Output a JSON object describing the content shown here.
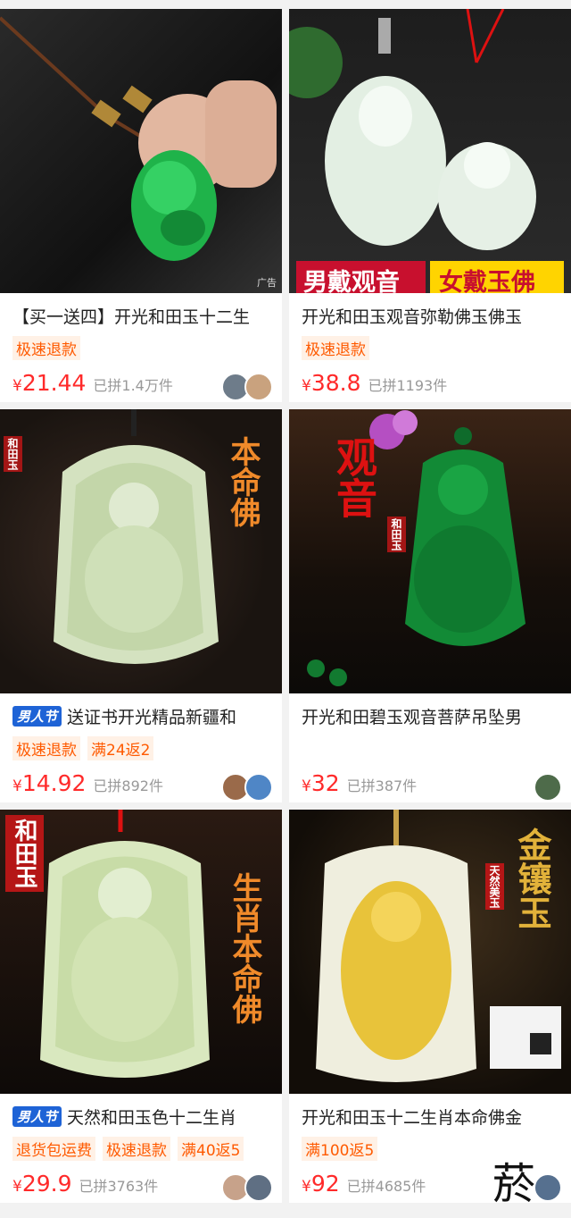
{
  "products": [
    {
      "title": "【买一送四】开光和田玉十二生",
      "festival": "",
      "tags": [
        "极速退款"
      ],
      "price": "21.44",
      "sold": "已拼1.4万件",
      "ad_label": "广告",
      "image_text": [],
      "avatars": 2
    },
    {
      "title": "开光和田玉观音弥勒佛玉佛玉",
      "festival": "",
      "tags": [
        "极速退款"
      ],
      "price": "38.8",
      "sold": "已拼1193件",
      "image_text": [
        "男戴观音",
        "女戴玉佛"
      ],
      "avatars": 0
    },
    {
      "title": "送证书开光精品新疆和",
      "festival": "男人节",
      "tags": [
        "极速退款",
        "满24返2"
      ],
      "price": "14.92",
      "sold": "已拼892件",
      "image_text": [
        "本命佛",
        "和田玉"
      ],
      "avatars": 2
    },
    {
      "title": "开光和田碧玉观音菩萨吊坠男",
      "festival": "",
      "tags": [],
      "price": "32",
      "sold": "已拼387件",
      "image_text": [
        "观音",
        "和田玉"
      ],
      "avatars": 1
    },
    {
      "title": "天然和田玉色十二生肖",
      "festival": "男人节",
      "tags": [
        "退货包运费",
        "极速退款",
        "满40返5"
      ],
      "price": "29.9",
      "sold": "已拼3763件",
      "image_text": [
        "和田玉",
        "生肖本命佛"
      ],
      "avatars": 2
    },
    {
      "title": "开光和田玉十二生肖本命佛金",
      "festival": "",
      "tags": [
        "满100返5"
      ],
      "price": "92",
      "sold": "已拼4685件",
      "image_text": [
        "金镶玉",
        "天然美玉"
      ],
      "avatars": 1
    }
  ],
  "currency": "¥",
  "watermark": "菸"
}
